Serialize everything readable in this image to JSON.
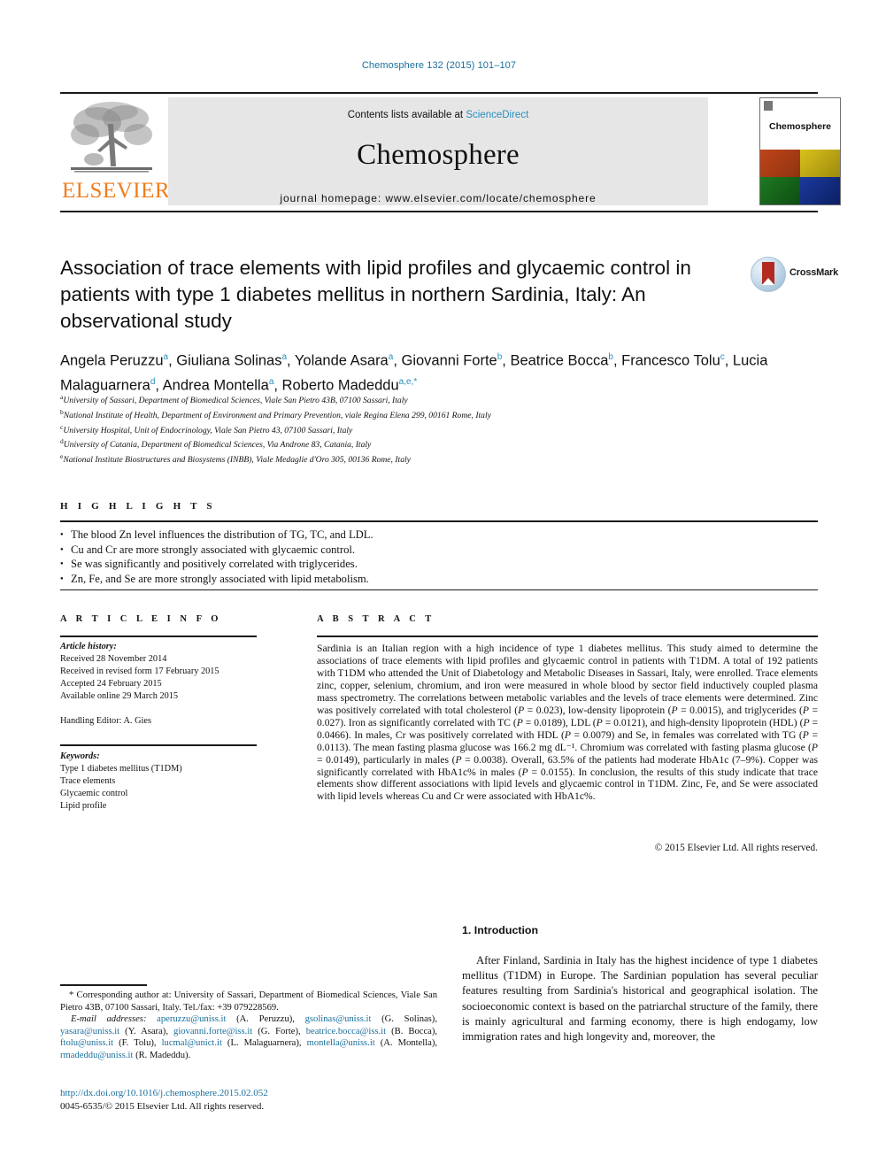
{
  "citation": "Chemosphere 132 (2015) 101–107",
  "journal_header": {
    "publisher_name": "ELSEVIER",
    "publisher_logo_icon": "elsevier-tree-logo",
    "contents_prefix": "Contents lists available at ",
    "sciencedirect": "ScienceDirect",
    "journal_name": "Chemosphere",
    "homepage": "journal homepage: www.elsevier.com/locate/chemosphere",
    "cover_title": "Chemosphere"
  },
  "article": {
    "title": "Association of trace elements with lipid profiles and glycaemic control in patients with type 1 diabetes mellitus in northern Sardinia, Italy: An observational study",
    "crossmark_label": "CrossMark",
    "authors": [
      {
        "name": "Angela Peruzzu",
        "sup": "a",
        "sep": ", "
      },
      {
        "name": "Giuliana Solinas",
        "sup": "a",
        "sep": ", "
      },
      {
        "name": "Yolande Asara",
        "sup": "a",
        "sep": ", "
      },
      {
        "name": "Giovanni Forte",
        "sup": "b",
        "sep": ", "
      },
      {
        "name": "Beatrice Bocca",
        "sup": "b",
        "sep": ", "
      },
      {
        "name": "Francesco Tolu",
        "sup": "c",
        "sep": ", "
      },
      {
        "name": "Lucia Malaguarnera",
        "sup": "d",
        "sep": ", "
      },
      {
        "name": "Andrea Montella",
        "sup": "a",
        "sep": ", "
      },
      {
        "name": "Roberto Madeddu",
        "sup": "a,e,*",
        "sep": ""
      }
    ],
    "affiliations": [
      {
        "mark": "a",
        "text": "University of Sassari, Department of Biomedical Sciences, Viale San Pietro 43B, 07100 Sassari, Italy"
      },
      {
        "mark": "b",
        "text": "National Institute of Health, Department of Environment and Primary Prevention, viale Regina Elena 299, 00161 Rome, Italy"
      },
      {
        "mark": "c",
        "text": "University Hospital, Unit of Endocrinology, Viale San Pietro 43, 07100 Sassari, Italy"
      },
      {
        "mark": "d",
        "text": "University of Catania, Department of Biomedical Sciences, Via Androne 83, Catania, Italy"
      },
      {
        "mark": "e",
        "text": "National Institute Biostructures and Biosystems (INBB), Viale Medaglie d'Oro 305, 00136 Rome, Italy"
      }
    ]
  },
  "highlights": {
    "label": "H I G H L I G H T S",
    "items": [
      "The blood Zn level influences the distribution of TG, TC, and LDL.",
      "Cu and Cr are more strongly associated with glycaemic control.",
      "Se was significantly and positively correlated with triglycerides.",
      "Zn, Fe, and Se are more strongly associated with lipid metabolism."
    ]
  },
  "article_info": {
    "label": "A R T I C L E   I N F O",
    "history_label": "Article history:",
    "history": [
      "Received 28 November 2014",
      "Received in revised form 17 February 2015",
      "Accepted 24 February 2015",
      "Available online 29 March 2015"
    ],
    "handling_editor": "Handling Editor: A. Gies",
    "keywords_label": "Keywords:",
    "keywords": [
      "Type 1 diabetes mellitus (T1DM)",
      "Trace elements",
      "Glycaemic control",
      "Lipid profile"
    ]
  },
  "abstract": {
    "label": "A B S T R A C T",
    "text": "Sardinia is an Italian region with a high incidence of type 1 diabetes mellitus. This study aimed to determine the associations of trace elements with lipid profiles and glycaemic control in patients with T1DM. A total of 192 patients with T1DM who attended the Unit of Diabetology and Metabolic Diseases in Sassari, Italy, were enrolled. Trace elements zinc, copper, selenium, chromium, and iron were measured in whole blood by sector field inductively coupled plasma mass spectrometry. The correlations between metabolic variables and the levels of trace elements were determined. Zinc was positively correlated with total cholesterol (P = 0.023), low-density lipoprotein (P = 0.0015), and triglycerides (P = 0.027). Iron as significantly correlated with TC (P = 0.0189), LDL (P = 0.0121), and high-density lipoprotein (HDL) (P = 0.0466). In males, Cr was positively correlated with HDL (P = 0.0079) and Se, in females was correlated with TG (P = 0.0113). The mean fasting plasma glucose was 166.2 mg dL⁻¹. Chromium was correlated with fasting plasma glucose (P = 0.0149), particularly in males (P = 0.0038). Overall, 63.5% of the patients had moderate HbA1c (7–9%). Copper was significantly correlated with HbA1c% in males (P = 0.0155). In conclusion, the results of this study indicate that trace elements show different associations with lipid levels and glycaemic control in T1DM. Zinc, Fe, and Se were associated with lipid levels whereas Cu and Cr were associated with HbA1c%.",
    "copyright": "© 2015 Elsevier Ltd. All rights reserved."
  },
  "introduction": {
    "heading": "1. Introduction",
    "text": "After Finland, Sardinia in Italy has the highest incidence of type 1 diabetes mellitus (T1DM) in Europe. The Sardinian population has several peculiar features resulting from Sardinia's historical and geographical isolation. The socioeconomic context is based on the patriarchal structure of the family, there is mainly agricultural and farming economy, there is high endogamy, low immigration rates and high longevity and, moreover, the"
  },
  "footnote": {
    "corresponding": "* Corresponding author at: University of Sassari, Department of Biomedical Sciences, Viale San Pietro 43B, 07100 Sassari, Italy. Tel./fax: +39 079228569.",
    "email_label": "E-mail addresses:",
    "emails": [
      {
        "addr": "aperuzzu@uniss.it",
        "who": " (A. Peruzzu), "
      },
      {
        "addr": "gsolinas@uniss.it",
        "who": " (G. Solinas), "
      },
      {
        "addr": "yasara@uniss.it",
        "who": " (Y. Asara), "
      },
      {
        "addr": "giovanni.forte@iss.it",
        "who": " (G. Forte), "
      },
      {
        "addr": "beatrice.bocca@iss.it",
        "who": " (B. Bocca), "
      },
      {
        "addr": "ftolu@uniss.it",
        "who": " (F. Tolu), "
      },
      {
        "addr": "lucmal@unict.it",
        "who": " (L. Malaguarnera), "
      },
      {
        "addr": "montella@uniss.it",
        "who": " (A. Montella), "
      },
      {
        "addr": "rmadeddu@uniss.it",
        "who": " (R. Madeddu)."
      }
    ],
    "doi": "http://dx.doi.org/10.1016/j.chemosphere.2015.02.052",
    "issn_line": "0045-6535/© 2015 Elsevier Ltd. All rights reserved."
  },
  "colors": {
    "link_blue": "#1a6f9c",
    "sciencedirect_blue": "#2a8fbd",
    "elsevier_orange": "#f07d1a",
    "band_grey": "#e6e6e6"
  }
}
